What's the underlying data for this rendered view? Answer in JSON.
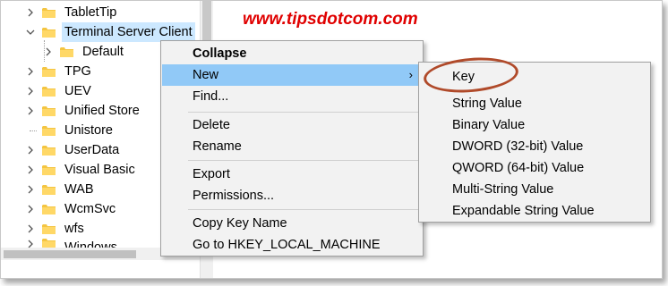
{
  "watermark": "www.tipsdotcom.com",
  "tree": {
    "items": [
      {
        "label": "TabletTip",
        "chev": "right"
      },
      {
        "label": "Terminal Server Client",
        "chev": "down"
      },
      {
        "label": "Default",
        "chev": "right"
      },
      {
        "label": "TPG",
        "chev": "right"
      },
      {
        "label": "UEV",
        "chev": "right"
      },
      {
        "label": "Unified Store",
        "chev": "right"
      },
      {
        "label": "Unistore",
        "chev": "none"
      },
      {
        "label": "UserData",
        "chev": "right"
      },
      {
        "label": "Visual Basic",
        "chev": "right"
      },
      {
        "label": "WAB",
        "chev": "right"
      },
      {
        "label": "WcmSvc",
        "chev": "right"
      },
      {
        "label": "wfs",
        "chev": "right"
      },
      {
        "label": "Windows",
        "chev": "right"
      }
    ]
  },
  "context_menu": {
    "items": {
      "collapse": "Collapse",
      "new": "New",
      "find": "Find...",
      "delete": "Delete",
      "rename": "Rename",
      "export": "Export",
      "permissions": "Permissions...",
      "copy_key_name": "Copy Key Name",
      "goto": "Go to HKEY_LOCAL_MACHINE"
    },
    "submenu_arrow": "›"
  },
  "new_submenu": {
    "items": {
      "key": "Key",
      "string": "String Value",
      "binary": "Binary Value",
      "dword": "DWORD (32-bit) Value",
      "qword": "QWORD (64-bit) Value",
      "multi": "Multi-String Value",
      "expandable": "Expandable String Value"
    }
  },
  "colors": {
    "selection": "#cce8ff",
    "menu_highlight": "#91c9f7",
    "watermark": "#e00000",
    "folder": "#f4c542",
    "annotation": "#b04a2a"
  }
}
